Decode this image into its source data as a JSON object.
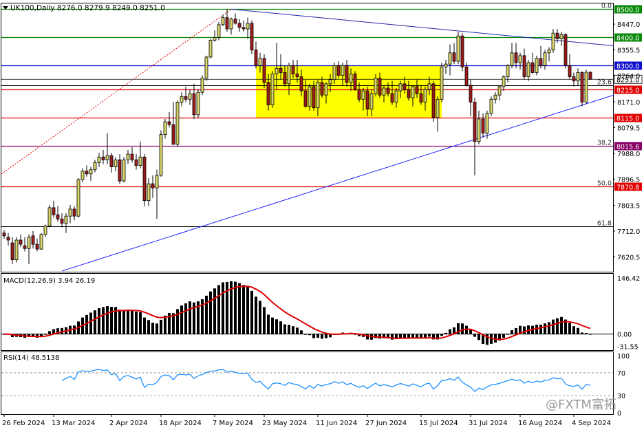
{
  "header": {
    "title": "UK100,Daily  8276.0  8279.9  8249.0  8251.0"
  },
  "watermark": "@FXTM富拓",
  "chart_data": [
    {
      "type": "candlestick",
      "symbol": "UK100",
      "timeframe": "Daily",
      "ohlc_last": {
        "open": 8276.0,
        "high": 8279.9,
        "low": 8249.0,
        "close": 8251.0
      },
      "ylim": [
        7570,
        8518
      ],
      "y_ticks": [
        8447.0,
        8355.5,
        8264.0,
        8171.0,
        8079.5,
        7988.0,
        7896.5,
        7803.5,
        7712.0,
        7620.5
      ],
      "last_price_label": "8251.0",
      "colors": {
        "up": "#d9d46b",
        "down": "#a01c1c",
        "outline": "#000000",
        "band": "#ffff00"
      },
      "x_labels": [
        {
          "i": 0,
          "label": "26 Feb 2024"
        },
        {
          "i": 12,
          "label": "13 Mar 2024"
        },
        {
          "i": 26,
          "label": "2 Apr 2024"
        },
        {
          "i": 38,
          "label": "18 Apr 2024"
        },
        {
          "i": 51,
          "label": "7 May 2024"
        },
        {
          "i": 63,
          "label": "23 May 2024"
        },
        {
          "i": 76,
          "label": "11 Jun 2024"
        },
        {
          "i": 88,
          "label": "27 Jun 2024"
        },
        {
          "i": 101,
          "label": "15 Jul 2024"
        },
        {
          "i": 113,
          "label": "31 Jul 2024"
        },
        {
          "i": 125,
          "label": "16 Aug 2024"
        },
        {
          "i": 138,
          "label": "4 Sep 2024"
        }
      ],
      "horizontal_levels": [
        {
          "value": 8500.0,
          "label": "8500.0",
          "color": "#0a8a0a"
        },
        {
          "value": 8400.0,
          "label": "8400.0",
          "color": "#0a8a0a"
        },
        {
          "value": 8300.0,
          "label": "8300.0",
          "color": "#1010cc"
        },
        {
          "value": 8215.0,
          "label": "8215.0",
          "color": "#e00000"
        },
        {
          "value": 8115.0,
          "label": "8115.0",
          "color": "#e00000"
        },
        {
          "value": 8015.6,
          "label": "8015.6",
          "color": "#880066"
        },
        {
          "value": 7870.8,
          "label": "7870.8",
          "color": "#e00000"
        }
      ],
      "fib_levels": [
        {
          "pct": "0.0",
          "value": 8500.0
        },
        {
          "pct": "23.6",
          "value": 8229.0
        },
        {
          "pct": "38.2",
          "value": 8015.6
        },
        {
          "pct": "50.0",
          "value": 7870.8
        },
        {
          "pct": "61.8",
          "value": 7728.0
        }
      ],
      "consolidation_band": {
        "i_start": 61,
        "i_end": 106,
        "low": 8115.0,
        "high": 8300.0
      },
      "trendlines": [
        {
          "from": {
            "i": 55,
            "p": 8500
          },
          "to": {
            "i": 147,
            "p": 8370
          },
          "color": "#2222aa"
        },
        {
          "from": {
            "i": 14,
            "p": 7570
          },
          "to": {
            "i": 147,
            "p": 8195
          },
          "color": "#2222ff"
        }
      ],
      "candles": [
        [
          7705,
          7715,
          7685,
          7695
        ],
        [
          7690,
          7705,
          7660,
          7680
        ],
        [
          7670,
          7690,
          7595,
          7610
        ],
        [
          7610,
          7690,
          7600,
          7680
        ],
        [
          7680,
          7700,
          7655,
          7665
        ],
        [
          7660,
          7690,
          7640,
          7650
        ],
        [
          7650,
          7700,
          7595,
          7690
        ],
        [
          7695,
          7712,
          7650,
          7665
        ],
        [
          7665,
          7685,
          7640,
          7648
        ],
        [
          7648,
          7705,
          7645,
          7700
        ],
        [
          7700,
          7735,
          7690,
          7730
        ],
        [
          7730,
          7805,
          7725,
          7795
        ],
        [
          7795,
          7820,
          7760,
          7770
        ],
        [
          7770,
          7800,
          7745,
          7755
        ],
        [
          7755,
          7775,
          7725,
          7740
        ],
        [
          7740,
          7775,
          7705,
          7765
        ],
        [
          7765,
          7805,
          7740,
          7790
        ],
        [
          7790,
          7800,
          7750,
          7765
        ],
        [
          7765,
          7900,
          7760,
          7895
        ],
        [
          7895,
          7935,
          7885,
          7925
        ],
        [
          7925,
          7945,
          7905,
          7915
        ],
        [
          7915,
          7940,
          7890,
          7930
        ],
        [
          7930,
          7965,
          7920,
          7955
        ],
        [
          7955,
          7990,
          7940,
          7975
        ],
        [
          7975,
          8000,
          7950,
          7965
        ],
        [
          7965,
          8060,
          7950,
          7980
        ],
        [
          7980,
          7990,
          7920,
          7940
        ],
        [
          7940,
          7975,
          7925,
          7965
        ],
        [
          7965,
          7985,
          7880,
          7890
        ],
        [
          7890,
          7975,
          7885,
          7965
        ],
        [
          7965,
          8000,
          7950,
          7985
        ],
        [
          7985,
          8010,
          7955,
          7965
        ],
        [
          7965,
          7985,
          7930,
          7945
        ],
        [
          7945,
          8030,
          7935,
          7975
        ],
        [
          7975,
          7985,
          7800,
          7820
        ],
        [
          7820,
          7900,
          7800,
          7880
        ],
        [
          7880,
          7910,
          7830,
          7865
        ],
        [
          7865,
          7930,
          7755,
          7910
        ],
        [
          7910,
          8070,
          7905,
          8055
        ],
        [
          8055,
          8110,
          8040,
          8100
        ],
        [
          8100,
          8135,
          8080,
          8090
        ],
        [
          8090,
          8170,
          8020,
          8020
        ],
        [
          8020,
          8175,
          8010,
          8170
        ],
        [
          8170,
          8205,
          8155,
          8190
        ],
        [
          8190,
          8225,
          8170,
          8180
        ],
        [
          8180,
          8215,
          8160,
          8200
        ],
        [
          8200,
          8235,
          8110,
          8125
        ],
        [
          8125,
          8215,
          8115,
          8205
        ],
        [
          8205,
          8265,
          8195,
          8255
        ],
        [
          8255,
          8335,
          8245,
          8330
        ],
        [
          8330,
          8395,
          8325,
          8390
        ],
        [
          8390,
          8425,
          8385,
          8400
        ],
        [
          8400,
          8455,
          8390,
          8445
        ],
        [
          8445,
          8480,
          8440,
          8470
        ],
        [
          8470,
          8500,
          8420,
          8430
        ],
        [
          8430,
          8470,
          8410,
          8465
        ],
        [
          8465,
          8485,
          8445,
          8450
        ],
        [
          8450,
          8465,
          8420,
          8435
        ],
        [
          8435,
          8460,
          8420,
          8430
        ],
        [
          8430,
          8470,
          8395,
          8450
        ],
        [
          8450,
          8460,
          8340,
          8355
        ],
        [
          8355,
          8385,
          8290,
          8300
        ],
        [
          8300,
          8345,
          8275,
          8325
        ],
        [
          8325,
          8340,
          8220,
          8240
        ],
        [
          8240,
          8270,
          8140,
          8160
        ],
        [
          8160,
          8280,
          8150,
          8270
        ],
        [
          8270,
          8380,
          8215,
          8290
        ],
        [
          8290,
          8340,
          8250,
          8275
        ],
        [
          8275,
          8300,
          8225,
          8235
        ],
        [
          8235,
          8310,
          8195,
          8300
        ],
        [
          8300,
          8320,
          8255,
          8270
        ],
        [
          8270,
          8320,
          8240,
          8260
        ],
        [
          8260,
          8285,
          8190,
          8210
        ],
        [
          8210,
          8250,
          8150,
          8155
        ],
        [
          8155,
          8235,
          8140,
          8225
        ],
        [
          8225,
          8245,
          8140,
          8150
        ],
        [
          8150,
          8250,
          8120,
          8240
        ],
        [
          8240,
          8260,
          8185,
          8195
        ],
        [
          8195,
          8240,
          8165,
          8235
        ],
        [
          8235,
          8270,
          8205,
          8250
        ],
        [
          8250,
          8310,
          8235,
          8300
        ],
        [
          8300,
          8315,
          8255,
          8265
        ],
        [
          8265,
          8310,
          8230,
          8300
        ],
        [
          8300,
          8320,
          8225,
          8240
        ],
        [
          8240,
          8290,
          8210,
          8270
        ],
        [
          8270,
          8280,
          8210,
          8215
        ],
        [
          8215,
          8240,
          8170,
          8180
        ],
        [
          8180,
          8220,
          8140,
          8210
        ],
        [
          8210,
          8225,
          8120,
          8145
        ],
        [
          8145,
          8215,
          8120,
          8200
        ],
        [
          8200,
          8270,
          8190,
          8255
        ],
        [
          8255,
          8275,
          8185,
          8195
        ],
        [
          8195,
          8230,
          8170,
          8220
        ],
        [
          8220,
          8240,
          8190,
          8200
        ],
        [
          8200,
          8245,
          8160,
          8170
        ],
        [
          8170,
          8220,
          8150,
          8210
        ],
        [
          8210,
          8245,
          8185,
          8235
        ],
        [
          8235,
          8260,
          8200,
          8215
        ],
        [
          8215,
          8245,
          8175,
          8185
        ],
        [
          8185,
          8230,
          8155,
          8225
        ],
        [
          8225,
          8250,
          8185,
          8200
        ],
        [
          8200,
          8230,
          8160,
          8170
        ],
        [
          8170,
          8225,
          8140,
          8215
        ],
        [
          8215,
          8260,
          8195,
          8235
        ],
        [
          8235,
          8245,
          8100,
          8115
        ],
        [
          8115,
          8190,
          8065,
          8180
        ],
        [
          8180,
          8310,
          8170,
          8295
        ],
        [
          8295,
          8320,
          8270,
          8305
        ],
        [
          8305,
          8375,
          8265,
          8345
        ],
        [
          8345,
          8380,
          8305,
          8315
        ],
        [
          8315,
          8420,
          8305,
          8405
        ],
        [
          8405,
          8415,
          8280,
          8295
        ],
        [
          8295,
          8310,
          8225,
          8230
        ],
        [
          8230,
          8250,
          8120,
          8170
        ],
        [
          8170,
          8185,
          7910,
          8030
        ],
        [
          8030,
          8140,
          8020,
          8110
        ],
        [
          8110,
          8130,
          8045,
          8060
        ],
        [
          8060,
          8140,
          8040,
          8130
        ],
        [
          8130,
          8190,
          8120,
          8180
        ],
        [
          8180,
          8205,
          8165,
          8195
        ],
        [
          8195,
          8230,
          8175,
          8225
        ],
        [
          8225,
          8265,
          8210,
          8260
        ],
        [
          8260,
          8305,
          8240,
          8300
        ],
        [
          8300,
          8380,
          8290,
          8345
        ],
        [
          8345,
          8380,
          8290,
          8310
        ],
        [
          8310,
          8345,
          8285,
          8335
        ],
        [
          8335,
          8360,
          8250,
          8260
        ],
        [
          8260,
          8320,
          8245,
          8310
        ],
        [
          8310,
          8345,
          8270,
          8275
        ],
        [
          8275,
          8335,
          8265,
          8325
        ],
        [
          8325,
          8370,
          8290,
          8300
        ],
        [
          8300,
          8355,
          8285,
          8345
        ],
        [
          8345,
          8365,
          8315,
          8355
        ],
        [
          8355,
          8430,
          8345,
          8415
        ],
        [
          8415,
          8430,
          8380,
          8395
        ],
        [
          8395,
          8420,
          8370,
          8410
        ],
        [
          8410,
          8415,
          8290,
          8300
        ],
        [
          8300,
          8340,
          8250,
          8260
        ],
        [
          8260,
          8275,
          8225,
          8245
        ],
        [
          8245,
          8290,
          8230,
          8275
        ],
        [
          8275,
          8280,
          8155,
          8170
        ],
        [
          8170,
          8285,
          8165,
          8276
        ],
        [
          8276,
          8279.9,
          8249,
          8251
        ]
      ],
      "panels": [
        {
          "name": "MACD",
          "label": "MACD(12,26,9) 3.94 26.19",
          "macd": 3.94,
          "signal": 26.19,
          "ylim": [
            -40,
            150
          ],
          "y_ticks": [
            146.42,
            0.0,
            -31.55
          ],
          "colors": {
            "hist": "#000000",
            "signal": "#e00000"
          }
        },
        {
          "name": "RSI",
          "label": "RSI(14) 48.5138",
          "value": 48.5138,
          "ylim": [
            0,
            100
          ],
          "y_ticks": [
            100,
            70,
            30,
            0
          ],
          "colors": {
            "line": "#1e90ff",
            "levels": "#9a9a9a"
          }
        }
      ]
    }
  ]
}
